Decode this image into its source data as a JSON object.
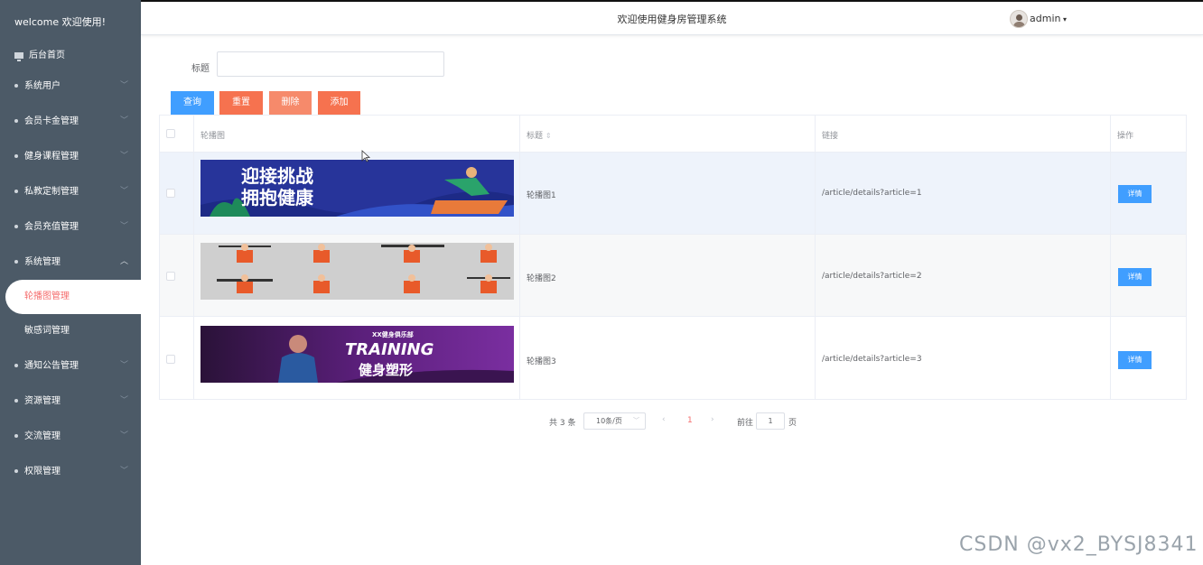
{
  "sidebar": {
    "brand": "welcome 欢迎使用!",
    "home": "后台首页",
    "items": [
      {
        "label": "系统用户"
      },
      {
        "label": "会员卡金管理"
      },
      {
        "label": "健身课程管理"
      },
      {
        "label": "私教定制管理"
      },
      {
        "label": "会员充值管理"
      },
      {
        "label": "系统管理"
      }
    ],
    "sub_items": [
      {
        "label": "轮播图管理",
        "active": true
      },
      {
        "label": "敏感词管理",
        "active": false
      }
    ],
    "items_after": [
      {
        "label": "通知公告管理"
      },
      {
        "label": "资源管理"
      },
      {
        "label": "交流管理"
      },
      {
        "label": "权限管理"
      }
    ]
  },
  "header": {
    "title": "欢迎使用健身房管理系统",
    "user": "admin"
  },
  "search": {
    "label": "标题",
    "value": "",
    "placeholder": ""
  },
  "toolbar": {
    "query": "查询",
    "reset": "重置",
    "delete": "删除",
    "add": "添加"
  },
  "table": {
    "headers": {
      "image": "轮播图",
      "title": "标题",
      "link": "链接",
      "action": "操作"
    },
    "rows": [
      {
        "title": "轮播图1",
        "link": "/article/details?article=1",
        "action": "详情",
        "banner_text": [
          "迎接挑战",
          "拥抱健康"
        ]
      },
      {
        "title": "轮播图2",
        "link": "/article/details?article=2",
        "action": "详情",
        "banner_text": []
      },
      {
        "title": "轮播图3",
        "link": "/article/details?article=3",
        "action": "详情",
        "banner_text": [
          "XX健身俱乐部",
          "TRAINING",
          "健身塑形"
        ]
      }
    ]
  },
  "pagination": {
    "total": "共 3 条",
    "page_size": "10条/页",
    "current_page": "1",
    "goto_label": "前往",
    "goto_value": "1",
    "page_suffix": "页"
  },
  "watermark": "CSDN @vx2_BYSJ8341",
  "colors": {
    "sidebar_bg": "#4c5a67",
    "primary": "#409eff",
    "danger": "#f6724f",
    "active": "#f56c6c"
  }
}
